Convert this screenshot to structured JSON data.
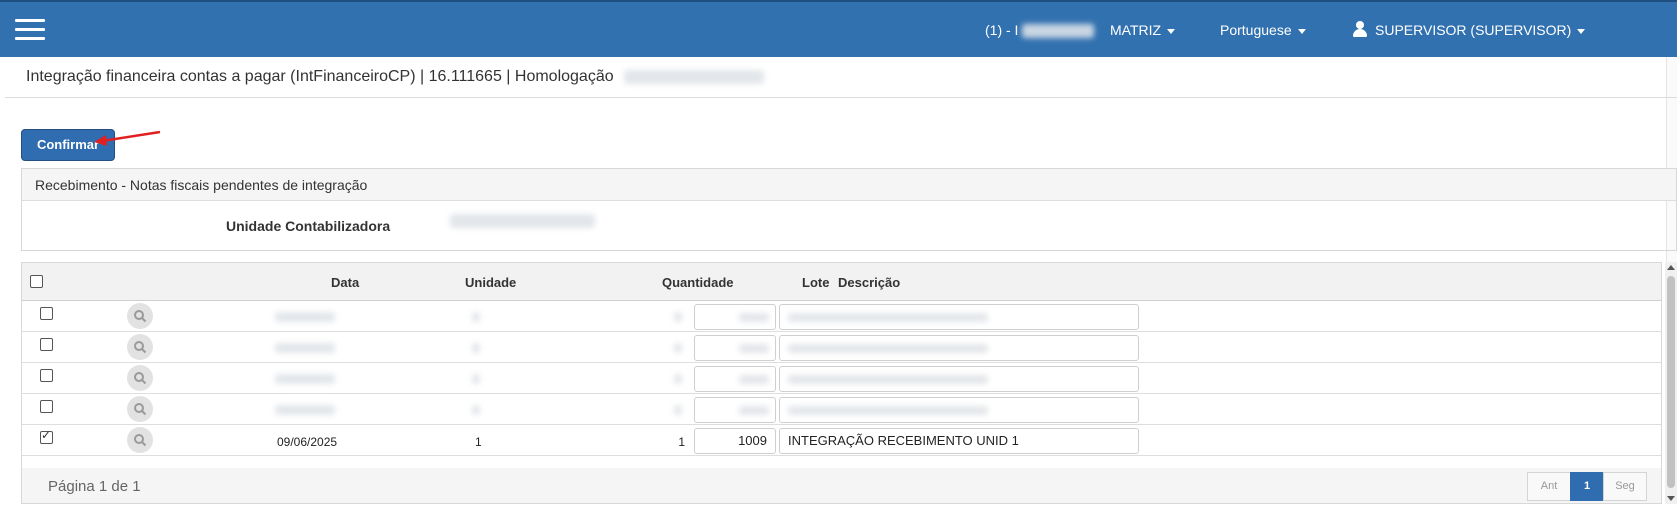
{
  "navbar": {
    "menu_icon": "hamburger-icon",
    "company_prefix": "(1) - I",
    "branch": "MATRIZ",
    "language": "Portuguese",
    "user_icon": "user-icon",
    "user": "SUPERVISOR (SUPERVISOR)"
  },
  "page": {
    "title": "Integração financeira contas a pagar (IntFinanceiroCP) | 16.111665 | Homologação"
  },
  "toolbar": {
    "confirm_label": "Confirmar"
  },
  "panel": {
    "header": "Recebimento - Notas fiscais pendentes de integração",
    "filter_label": "Unidade Contabilizadora"
  },
  "grid": {
    "columns": {
      "data": "Data",
      "unidade": "Unidade",
      "quantidade": "Quantidade",
      "lote": "Lote",
      "descricao": "Descrição"
    },
    "rows": [
      {
        "checked": false,
        "blurred": true,
        "data": "",
        "unidade": "",
        "quantidade": "",
        "lote": "",
        "descricao": ""
      },
      {
        "checked": false,
        "blurred": true,
        "data": "",
        "unidade": "",
        "quantidade": "",
        "lote": "",
        "descricao": ""
      },
      {
        "checked": false,
        "blurred": true,
        "data": "",
        "unidade": "",
        "quantidade": "",
        "lote": "",
        "descricao": ""
      },
      {
        "checked": false,
        "blurred": true,
        "data": "",
        "unidade": "",
        "quantidade": "",
        "lote": "",
        "descricao": ""
      },
      {
        "checked": true,
        "blurred": false,
        "data": "09/06/2025",
        "unidade": "1",
        "quantidade": "1",
        "lote": "1009",
        "descricao": "INTEGRAÇÃO RECEBIMENTO UNID 1"
      }
    ],
    "footer": {
      "page_info": "Página 1 de 1",
      "prev": "Ant",
      "current": "1",
      "next": "Seg"
    }
  },
  "colors": {
    "navbar": "#3271b0",
    "primary_button": "#2f6db0",
    "arrow": "#e02020"
  }
}
